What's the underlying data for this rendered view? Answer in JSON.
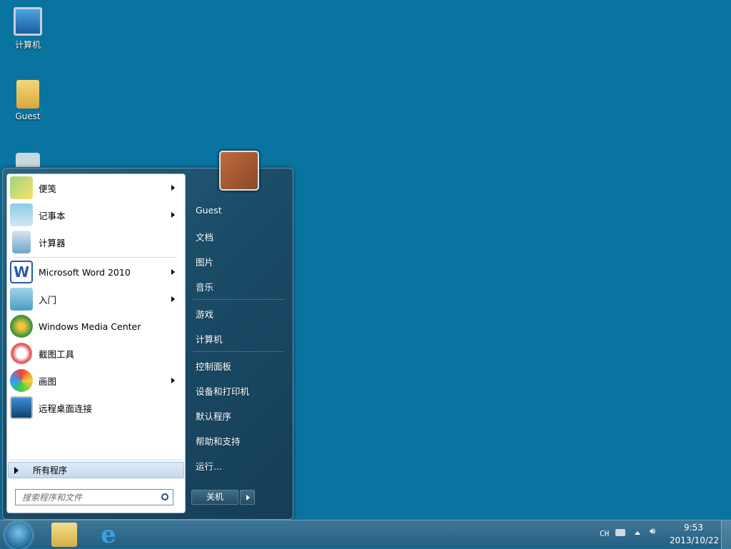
{
  "desktop": {
    "icons": [
      {
        "label": "计算机"
      },
      {
        "label": "Guest"
      }
    ]
  },
  "start_menu": {
    "programs": [
      {
        "label": "便笺",
        "submenu": true
      },
      {
        "label": "记事本",
        "submenu": true
      },
      {
        "label": "计算器",
        "submenu": false
      },
      {
        "label": "Microsoft Word 2010",
        "submenu": true
      },
      {
        "label": "入门",
        "submenu": true
      },
      {
        "label": "Windows Media Center",
        "submenu": false
      },
      {
        "label": "截图工具",
        "submenu": false
      },
      {
        "label": "画图",
        "submenu": true
      },
      {
        "label": "远程桌面连接",
        "submenu": false
      }
    ],
    "all_programs": "所有程序",
    "search_placeholder": "搜索程序和文件",
    "right": [
      "Guest",
      "文档",
      "图片",
      "音乐",
      "游戏",
      "计算机",
      "控制面板",
      "设备和打印机",
      "默认程序",
      "帮助和支持",
      "运行..."
    ],
    "shutdown": "关机"
  },
  "tray": {
    "lang": "CH",
    "time": "9:53",
    "date": "2013/10/22"
  }
}
